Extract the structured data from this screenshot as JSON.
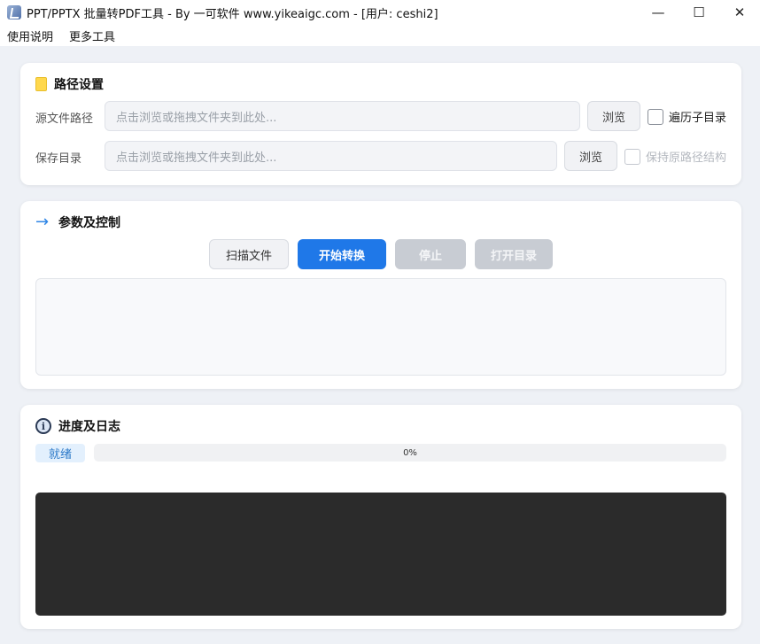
{
  "window": {
    "title": "PPT/PPTX 批量转PDF工具 - By 一可软件 www.yikeaigc.com - [用户: ceshi2]",
    "minimize_glyph": "—",
    "maximize_glyph": "☐",
    "close_glyph": "✕"
  },
  "menu": {
    "items": [
      "使用说明",
      "更多工具"
    ]
  },
  "path_panel": {
    "title": "路径设置",
    "icon": "folder-icon",
    "source_label": "源文件路径",
    "source_placeholder": "点击浏览或拖拽文件夹到此处...",
    "source_browse": "浏览",
    "traverse_label": "遍历子目录",
    "save_label": "保存目录",
    "save_placeholder": "点击浏览或拖拽文件夹到此处...",
    "save_browse": "浏览",
    "keep_structure_label": "保持原路径结构"
  },
  "control_panel": {
    "title": "参数及控制",
    "icon": "arrow-right-icon",
    "arrow_glyph": "→",
    "scan_label": "扫描文件",
    "start_label": "开始转换",
    "stop_label": "停止",
    "open_dir_label": "打开目录"
  },
  "progress_panel": {
    "title": "进度及日志",
    "icon": "info-icon",
    "info_glyph": "i",
    "status": "就绪",
    "progress_text": "0%",
    "progress_value": 0,
    "log_text": ""
  },
  "colors": {
    "accent": "#1f78e8",
    "disabled": "#c8ccd3",
    "log_bg": "#2b2b2b",
    "status_bg": "#e3f0fd"
  }
}
